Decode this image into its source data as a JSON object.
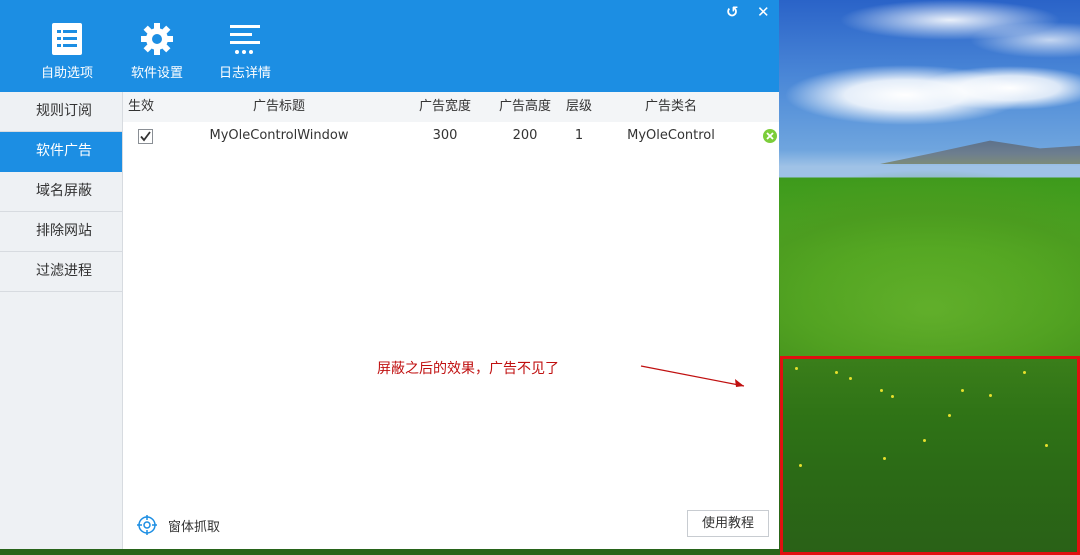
{
  "toolbar": {
    "buttons": [
      {
        "label": "自助选项",
        "icon": "list-check-icon"
      },
      {
        "label": "软件设置",
        "icon": "gear-icon"
      },
      {
        "label": "日志详情",
        "icon": "log-lines-icon"
      }
    ],
    "restore_glyph": "↺",
    "close_glyph": "✕"
  },
  "sidebar": {
    "items": [
      {
        "label": "规则订阅",
        "active": false
      },
      {
        "label": "软件广告",
        "active": true
      },
      {
        "label": "域名屏蔽",
        "active": false
      },
      {
        "label": "排除网站",
        "active": false
      },
      {
        "label": "过滤进程",
        "active": false
      }
    ]
  },
  "table": {
    "headers": {
      "enabled": "生效",
      "title": "广告标题",
      "width": "广告宽度",
      "height": "广告高度",
      "layer": "层级",
      "class_name": "广告类名"
    },
    "rows": [
      {
        "enabled": true,
        "title": "MyOleControlWindow",
        "width": "300",
        "height": "200",
        "layer": "1",
        "class_name": "MyOleControl"
      }
    ]
  },
  "annotation": {
    "text": "屏蔽之后的效果，广告不见了",
    "color": "#c01010"
  },
  "footer": {
    "grab_label": "窗体抓取",
    "tutorial_label": "使用教程"
  },
  "colors": {
    "accent": "#1c8ee3",
    "highlight_border": "#e01010",
    "remove_icon": "#7ccd3a"
  }
}
